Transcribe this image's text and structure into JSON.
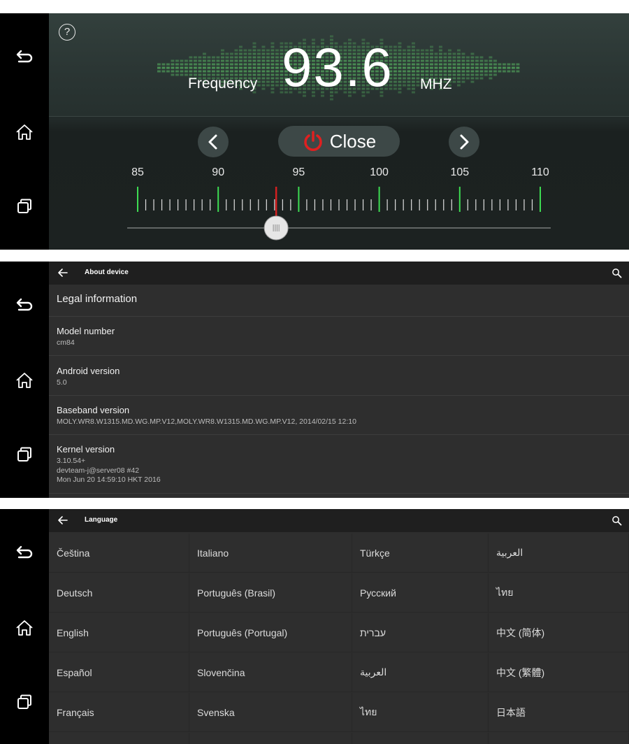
{
  "radio": {
    "help_symbol": "?",
    "frequency_label": "Frequency",
    "frequency_value": "93.6",
    "unit": "MHZ",
    "close_label": "Close",
    "scale_min": 85,
    "scale_max": 110,
    "scale_labels": [
      "85",
      "90",
      "95",
      "100",
      "105",
      "110"
    ],
    "current_frequency": 93.6,
    "needle_color": "#d32020",
    "major_tick_color": "#3ddc52",
    "eq_color": "#4e9a58"
  },
  "about": {
    "title": "About device",
    "items": [
      {
        "title": "Legal information"
      },
      {
        "title": "Model number",
        "summary": "cm84"
      },
      {
        "title": "Android version",
        "summary": "5.0"
      },
      {
        "title": "Baseband version",
        "summary": "MOLY.WR8.W1315.MD.WG.MP.V12,MOLY.WR8.W1315.MD.WG.MP.V12, 2014/02/15 12:10"
      },
      {
        "title": "Kernel version",
        "summary": "3.10.54+\ndevteam-j@server08 #42\nMon Jun 20 14:59:10 HKT 2016"
      }
    ]
  },
  "language": {
    "title": "Language",
    "columns": [
      [
        "Čeština",
        "Deutsch",
        "English",
        "Español",
        "Français"
      ],
      [
        "Italiano",
        "Português (Brasil)",
        "Português (Portugal)",
        "Slovenčina",
        "Svenska"
      ],
      [
        "Türkçe",
        "Русский",
        "עברית",
        "العربية",
        "ไทย"
      ],
      [
        "العربية",
        "ไทย",
        "中文 (简体)",
        "中文 (繁體)",
        "日本語"
      ]
    ]
  },
  "icons": {
    "back": "back-arrow-icon",
    "home": "home-icon",
    "recents": "recent-apps-icon",
    "search": "search-icon",
    "power": "power-icon"
  }
}
